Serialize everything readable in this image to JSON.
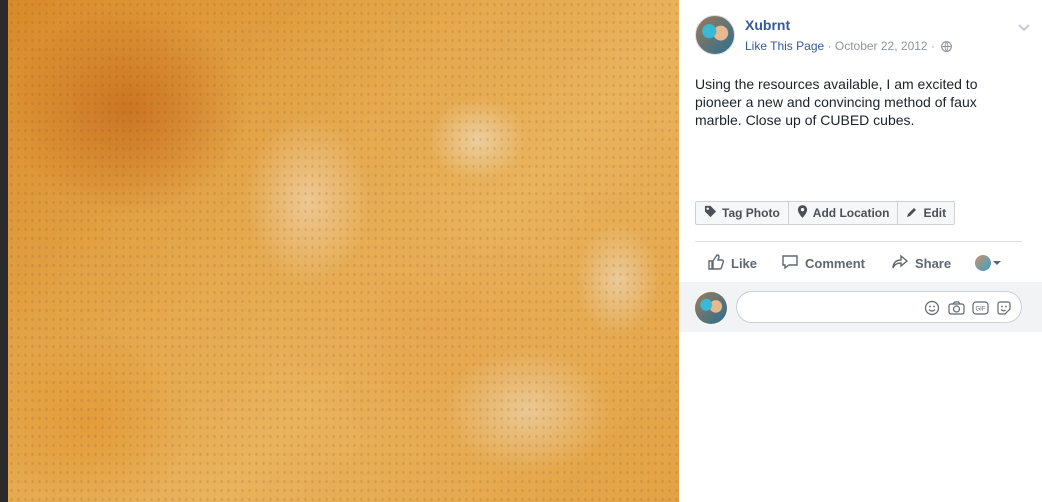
{
  "post": {
    "page_name": "Xubrnt",
    "like_page": "Like This Page",
    "date": "October 22, 2012",
    "caption": "Using the resources available, I am excited to pioneer a new and convincing method of faux marble. Close up of CUBED cubes."
  },
  "photo_actions": {
    "tag": "Tag Photo",
    "location": "Add Location",
    "edit": "Edit"
  },
  "reactions": {
    "like": "Like",
    "comment": "Comment",
    "share": "Share"
  },
  "icons": [
    "globe-icon",
    "chevron-down-icon",
    "tag-icon",
    "location-pin-icon",
    "pencil-icon",
    "thumbs-up-icon",
    "comment-icon",
    "share-arrow-icon",
    "emoji-icon",
    "camera-icon",
    "gif-icon",
    "sticker-icon"
  ],
  "colors": {
    "link": "#365899",
    "muted": "#90949c",
    "text": "#1d2129"
  }
}
